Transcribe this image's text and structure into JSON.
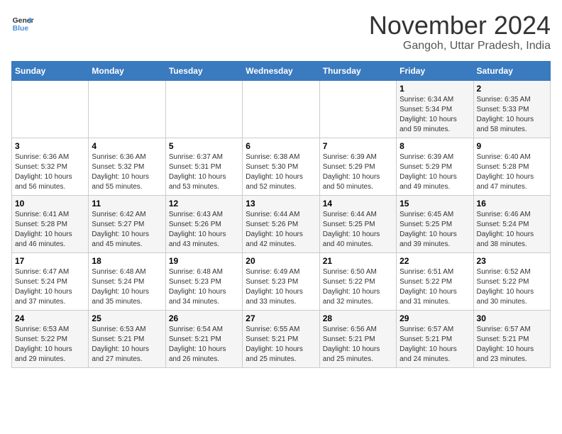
{
  "logo": {
    "line1": "General",
    "line2": "Blue"
  },
  "title": "November 2024",
  "location": "Gangoh, Uttar Pradesh, India",
  "days_of_week": [
    "Sunday",
    "Monday",
    "Tuesday",
    "Wednesday",
    "Thursday",
    "Friday",
    "Saturday"
  ],
  "weeks": [
    [
      {
        "day": "",
        "info": ""
      },
      {
        "day": "",
        "info": ""
      },
      {
        "day": "",
        "info": ""
      },
      {
        "day": "",
        "info": ""
      },
      {
        "day": "",
        "info": ""
      },
      {
        "day": "1",
        "info": "Sunrise: 6:34 AM\nSunset: 5:34 PM\nDaylight: 10 hours and 59 minutes."
      },
      {
        "day": "2",
        "info": "Sunrise: 6:35 AM\nSunset: 5:33 PM\nDaylight: 10 hours and 58 minutes."
      }
    ],
    [
      {
        "day": "3",
        "info": "Sunrise: 6:36 AM\nSunset: 5:32 PM\nDaylight: 10 hours and 56 minutes."
      },
      {
        "day": "4",
        "info": "Sunrise: 6:36 AM\nSunset: 5:32 PM\nDaylight: 10 hours and 55 minutes."
      },
      {
        "day": "5",
        "info": "Sunrise: 6:37 AM\nSunset: 5:31 PM\nDaylight: 10 hours and 53 minutes."
      },
      {
        "day": "6",
        "info": "Sunrise: 6:38 AM\nSunset: 5:30 PM\nDaylight: 10 hours and 52 minutes."
      },
      {
        "day": "7",
        "info": "Sunrise: 6:39 AM\nSunset: 5:29 PM\nDaylight: 10 hours and 50 minutes."
      },
      {
        "day": "8",
        "info": "Sunrise: 6:39 AM\nSunset: 5:29 PM\nDaylight: 10 hours and 49 minutes."
      },
      {
        "day": "9",
        "info": "Sunrise: 6:40 AM\nSunset: 5:28 PM\nDaylight: 10 hours and 47 minutes."
      }
    ],
    [
      {
        "day": "10",
        "info": "Sunrise: 6:41 AM\nSunset: 5:28 PM\nDaylight: 10 hours and 46 minutes."
      },
      {
        "day": "11",
        "info": "Sunrise: 6:42 AM\nSunset: 5:27 PM\nDaylight: 10 hours and 45 minutes."
      },
      {
        "day": "12",
        "info": "Sunrise: 6:43 AM\nSunset: 5:26 PM\nDaylight: 10 hours and 43 minutes."
      },
      {
        "day": "13",
        "info": "Sunrise: 6:44 AM\nSunset: 5:26 PM\nDaylight: 10 hours and 42 minutes."
      },
      {
        "day": "14",
        "info": "Sunrise: 6:44 AM\nSunset: 5:25 PM\nDaylight: 10 hours and 40 minutes."
      },
      {
        "day": "15",
        "info": "Sunrise: 6:45 AM\nSunset: 5:25 PM\nDaylight: 10 hours and 39 minutes."
      },
      {
        "day": "16",
        "info": "Sunrise: 6:46 AM\nSunset: 5:24 PM\nDaylight: 10 hours and 38 minutes."
      }
    ],
    [
      {
        "day": "17",
        "info": "Sunrise: 6:47 AM\nSunset: 5:24 PM\nDaylight: 10 hours and 37 minutes."
      },
      {
        "day": "18",
        "info": "Sunrise: 6:48 AM\nSunset: 5:24 PM\nDaylight: 10 hours and 35 minutes."
      },
      {
        "day": "19",
        "info": "Sunrise: 6:48 AM\nSunset: 5:23 PM\nDaylight: 10 hours and 34 minutes."
      },
      {
        "day": "20",
        "info": "Sunrise: 6:49 AM\nSunset: 5:23 PM\nDaylight: 10 hours and 33 minutes."
      },
      {
        "day": "21",
        "info": "Sunrise: 6:50 AM\nSunset: 5:22 PM\nDaylight: 10 hours and 32 minutes."
      },
      {
        "day": "22",
        "info": "Sunrise: 6:51 AM\nSunset: 5:22 PM\nDaylight: 10 hours and 31 minutes."
      },
      {
        "day": "23",
        "info": "Sunrise: 6:52 AM\nSunset: 5:22 PM\nDaylight: 10 hours and 30 minutes."
      }
    ],
    [
      {
        "day": "24",
        "info": "Sunrise: 6:53 AM\nSunset: 5:22 PM\nDaylight: 10 hours and 29 minutes."
      },
      {
        "day": "25",
        "info": "Sunrise: 6:53 AM\nSunset: 5:21 PM\nDaylight: 10 hours and 27 minutes."
      },
      {
        "day": "26",
        "info": "Sunrise: 6:54 AM\nSunset: 5:21 PM\nDaylight: 10 hours and 26 minutes."
      },
      {
        "day": "27",
        "info": "Sunrise: 6:55 AM\nSunset: 5:21 PM\nDaylight: 10 hours and 25 minutes."
      },
      {
        "day": "28",
        "info": "Sunrise: 6:56 AM\nSunset: 5:21 PM\nDaylight: 10 hours and 25 minutes."
      },
      {
        "day": "29",
        "info": "Sunrise: 6:57 AM\nSunset: 5:21 PM\nDaylight: 10 hours and 24 minutes."
      },
      {
        "day": "30",
        "info": "Sunrise: 6:57 AM\nSunset: 5:21 PM\nDaylight: 10 hours and 23 minutes."
      }
    ]
  ]
}
